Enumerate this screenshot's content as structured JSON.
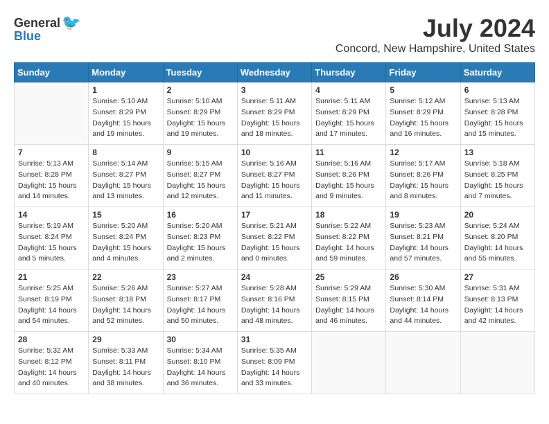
{
  "logo": {
    "general": "General",
    "blue": "Blue"
  },
  "title": "July 2024",
  "location": "Concord, New Hampshire, United States",
  "days_of_week": [
    "Sunday",
    "Monday",
    "Tuesday",
    "Wednesday",
    "Thursday",
    "Friday",
    "Saturday"
  ],
  "weeks": [
    [
      {
        "day": "",
        "info": ""
      },
      {
        "day": "1",
        "info": "Sunrise: 5:10 AM\nSunset: 8:29 PM\nDaylight: 15 hours\nand 19 minutes."
      },
      {
        "day": "2",
        "info": "Sunrise: 5:10 AM\nSunset: 8:29 PM\nDaylight: 15 hours\nand 19 minutes."
      },
      {
        "day": "3",
        "info": "Sunrise: 5:11 AM\nSunset: 8:29 PM\nDaylight: 15 hours\nand 18 minutes."
      },
      {
        "day": "4",
        "info": "Sunrise: 5:11 AM\nSunset: 8:29 PM\nDaylight: 15 hours\nand 17 minutes."
      },
      {
        "day": "5",
        "info": "Sunrise: 5:12 AM\nSunset: 8:29 PM\nDaylight: 15 hours\nand 16 minutes."
      },
      {
        "day": "6",
        "info": "Sunrise: 5:13 AM\nSunset: 8:28 PM\nDaylight: 15 hours\nand 15 minutes."
      }
    ],
    [
      {
        "day": "7",
        "info": "Sunrise: 5:13 AM\nSunset: 8:28 PM\nDaylight: 15 hours\nand 14 minutes."
      },
      {
        "day": "8",
        "info": "Sunrise: 5:14 AM\nSunset: 8:27 PM\nDaylight: 15 hours\nand 13 minutes."
      },
      {
        "day": "9",
        "info": "Sunrise: 5:15 AM\nSunset: 8:27 PM\nDaylight: 15 hours\nand 12 minutes."
      },
      {
        "day": "10",
        "info": "Sunrise: 5:16 AM\nSunset: 8:27 PM\nDaylight: 15 hours\nand 11 minutes."
      },
      {
        "day": "11",
        "info": "Sunrise: 5:16 AM\nSunset: 8:26 PM\nDaylight: 15 hours\nand 9 minutes."
      },
      {
        "day": "12",
        "info": "Sunrise: 5:17 AM\nSunset: 8:26 PM\nDaylight: 15 hours\nand 8 minutes."
      },
      {
        "day": "13",
        "info": "Sunrise: 5:18 AM\nSunset: 8:25 PM\nDaylight: 15 hours\nand 7 minutes."
      }
    ],
    [
      {
        "day": "14",
        "info": "Sunrise: 5:19 AM\nSunset: 8:24 PM\nDaylight: 15 hours\nand 5 minutes."
      },
      {
        "day": "15",
        "info": "Sunrise: 5:20 AM\nSunset: 8:24 PM\nDaylight: 15 hours\nand 4 minutes."
      },
      {
        "day": "16",
        "info": "Sunrise: 5:20 AM\nSunset: 8:23 PM\nDaylight: 15 hours\nand 2 minutes."
      },
      {
        "day": "17",
        "info": "Sunrise: 5:21 AM\nSunset: 8:22 PM\nDaylight: 15 hours\nand 0 minutes."
      },
      {
        "day": "18",
        "info": "Sunrise: 5:22 AM\nSunset: 8:22 PM\nDaylight: 14 hours\nand 59 minutes."
      },
      {
        "day": "19",
        "info": "Sunrise: 5:23 AM\nSunset: 8:21 PM\nDaylight: 14 hours\nand 57 minutes."
      },
      {
        "day": "20",
        "info": "Sunrise: 5:24 AM\nSunset: 8:20 PM\nDaylight: 14 hours\nand 55 minutes."
      }
    ],
    [
      {
        "day": "21",
        "info": "Sunrise: 5:25 AM\nSunset: 8:19 PM\nDaylight: 14 hours\nand 54 minutes."
      },
      {
        "day": "22",
        "info": "Sunrise: 5:26 AM\nSunset: 8:18 PM\nDaylight: 14 hours\nand 52 minutes."
      },
      {
        "day": "23",
        "info": "Sunrise: 5:27 AM\nSunset: 8:17 PM\nDaylight: 14 hours\nand 50 minutes."
      },
      {
        "day": "24",
        "info": "Sunrise: 5:28 AM\nSunset: 8:16 PM\nDaylight: 14 hours\nand 48 minutes."
      },
      {
        "day": "25",
        "info": "Sunrise: 5:29 AM\nSunset: 8:15 PM\nDaylight: 14 hours\nand 46 minutes."
      },
      {
        "day": "26",
        "info": "Sunrise: 5:30 AM\nSunset: 8:14 PM\nDaylight: 14 hours\nand 44 minutes."
      },
      {
        "day": "27",
        "info": "Sunrise: 5:31 AM\nSunset: 8:13 PM\nDaylight: 14 hours\nand 42 minutes."
      }
    ],
    [
      {
        "day": "28",
        "info": "Sunrise: 5:32 AM\nSunset: 8:12 PM\nDaylight: 14 hours\nand 40 minutes."
      },
      {
        "day": "29",
        "info": "Sunrise: 5:33 AM\nSunset: 8:11 PM\nDaylight: 14 hours\nand 38 minutes."
      },
      {
        "day": "30",
        "info": "Sunrise: 5:34 AM\nSunset: 8:10 PM\nDaylight: 14 hours\nand 36 minutes."
      },
      {
        "day": "31",
        "info": "Sunrise: 5:35 AM\nSunset: 8:09 PM\nDaylight: 14 hours\nand 33 minutes."
      },
      {
        "day": "",
        "info": ""
      },
      {
        "day": "",
        "info": ""
      },
      {
        "day": "",
        "info": ""
      }
    ]
  ]
}
